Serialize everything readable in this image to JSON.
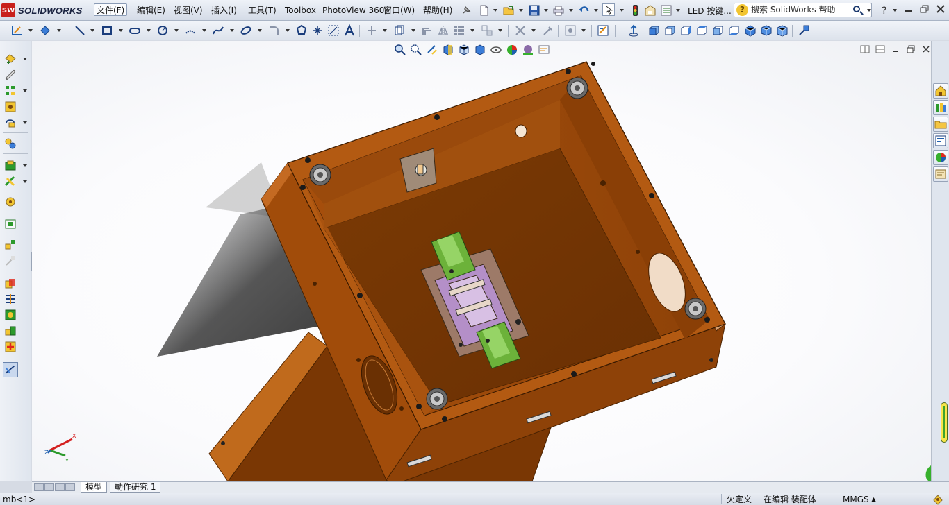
{
  "app": {
    "logo_text": "SOLIDWORKS",
    "logo_mark": "SW"
  },
  "menu": [
    {
      "label": "文件(F)",
      "active": true
    },
    {
      "label": "编辑(E)"
    },
    {
      "label": "视图(V)"
    },
    {
      "label": "插入(I)"
    },
    {
      "label": "工具(T)"
    },
    {
      "label": "Toolbox"
    },
    {
      "label": "PhotoView 360"
    },
    {
      "label": "窗口(W)"
    },
    {
      "label": "帮助(H)"
    }
  ],
  "titlebar": {
    "document_label": "LED 按键...",
    "search_placeholder": "搜索 SolidWorks 帮助",
    "help_glyph": "?"
  },
  "tabs": [
    {
      "label": "模型",
      "active": true
    },
    {
      "label": "動作研究 1",
      "active": false
    }
  ],
  "status": {
    "left": "mb<1>",
    "definition": "欠定义",
    "mode": "在编辑 装配体",
    "units": "MMGS"
  },
  "triad": {
    "x_label": "X",
    "y_label": "Y",
    "z_label": "Z"
  },
  "colors": {
    "wood_top": "#b35a12",
    "wood_side": "#8a3f06",
    "wood_inner": "#7d3a06",
    "green_part": "#6cb23a",
    "accent_blue": "#1f5fae"
  }
}
